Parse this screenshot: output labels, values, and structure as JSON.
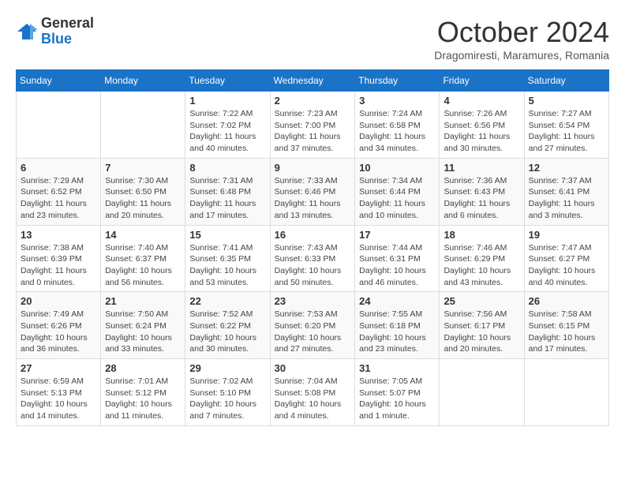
{
  "header": {
    "logo_general": "General",
    "logo_blue": "Blue",
    "month_title": "October 2024",
    "location": "Dragomiresti, Maramures, Romania"
  },
  "weekdays": [
    "Sunday",
    "Monday",
    "Tuesday",
    "Wednesday",
    "Thursday",
    "Friday",
    "Saturday"
  ],
  "weeks": [
    [
      {
        "day": "",
        "info": ""
      },
      {
        "day": "",
        "info": ""
      },
      {
        "day": "1",
        "info": "Sunrise: 7:22 AM\nSunset: 7:02 PM\nDaylight: 11 hours and 40 minutes."
      },
      {
        "day": "2",
        "info": "Sunrise: 7:23 AM\nSunset: 7:00 PM\nDaylight: 11 hours and 37 minutes."
      },
      {
        "day": "3",
        "info": "Sunrise: 7:24 AM\nSunset: 6:58 PM\nDaylight: 11 hours and 34 minutes."
      },
      {
        "day": "4",
        "info": "Sunrise: 7:26 AM\nSunset: 6:56 PM\nDaylight: 11 hours and 30 minutes."
      },
      {
        "day": "5",
        "info": "Sunrise: 7:27 AM\nSunset: 6:54 PM\nDaylight: 11 hours and 27 minutes."
      }
    ],
    [
      {
        "day": "6",
        "info": "Sunrise: 7:29 AM\nSunset: 6:52 PM\nDaylight: 11 hours and 23 minutes."
      },
      {
        "day": "7",
        "info": "Sunrise: 7:30 AM\nSunset: 6:50 PM\nDaylight: 11 hours and 20 minutes."
      },
      {
        "day": "8",
        "info": "Sunrise: 7:31 AM\nSunset: 6:48 PM\nDaylight: 11 hours and 17 minutes."
      },
      {
        "day": "9",
        "info": "Sunrise: 7:33 AM\nSunset: 6:46 PM\nDaylight: 11 hours and 13 minutes."
      },
      {
        "day": "10",
        "info": "Sunrise: 7:34 AM\nSunset: 6:44 PM\nDaylight: 11 hours and 10 minutes."
      },
      {
        "day": "11",
        "info": "Sunrise: 7:36 AM\nSunset: 6:43 PM\nDaylight: 11 hours and 6 minutes."
      },
      {
        "day": "12",
        "info": "Sunrise: 7:37 AM\nSunset: 6:41 PM\nDaylight: 11 hours and 3 minutes."
      }
    ],
    [
      {
        "day": "13",
        "info": "Sunrise: 7:38 AM\nSunset: 6:39 PM\nDaylight: 11 hours and 0 minutes."
      },
      {
        "day": "14",
        "info": "Sunrise: 7:40 AM\nSunset: 6:37 PM\nDaylight: 10 hours and 56 minutes."
      },
      {
        "day": "15",
        "info": "Sunrise: 7:41 AM\nSunset: 6:35 PM\nDaylight: 10 hours and 53 minutes."
      },
      {
        "day": "16",
        "info": "Sunrise: 7:43 AM\nSunset: 6:33 PM\nDaylight: 10 hours and 50 minutes."
      },
      {
        "day": "17",
        "info": "Sunrise: 7:44 AM\nSunset: 6:31 PM\nDaylight: 10 hours and 46 minutes."
      },
      {
        "day": "18",
        "info": "Sunrise: 7:46 AM\nSunset: 6:29 PM\nDaylight: 10 hours and 43 minutes."
      },
      {
        "day": "19",
        "info": "Sunrise: 7:47 AM\nSunset: 6:27 PM\nDaylight: 10 hours and 40 minutes."
      }
    ],
    [
      {
        "day": "20",
        "info": "Sunrise: 7:49 AM\nSunset: 6:26 PM\nDaylight: 10 hours and 36 minutes."
      },
      {
        "day": "21",
        "info": "Sunrise: 7:50 AM\nSunset: 6:24 PM\nDaylight: 10 hours and 33 minutes."
      },
      {
        "day": "22",
        "info": "Sunrise: 7:52 AM\nSunset: 6:22 PM\nDaylight: 10 hours and 30 minutes."
      },
      {
        "day": "23",
        "info": "Sunrise: 7:53 AM\nSunset: 6:20 PM\nDaylight: 10 hours and 27 minutes."
      },
      {
        "day": "24",
        "info": "Sunrise: 7:55 AM\nSunset: 6:18 PM\nDaylight: 10 hours and 23 minutes."
      },
      {
        "day": "25",
        "info": "Sunrise: 7:56 AM\nSunset: 6:17 PM\nDaylight: 10 hours and 20 minutes."
      },
      {
        "day": "26",
        "info": "Sunrise: 7:58 AM\nSunset: 6:15 PM\nDaylight: 10 hours and 17 minutes."
      }
    ],
    [
      {
        "day": "27",
        "info": "Sunrise: 6:59 AM\nSunset: 5:13 PM\nDaylight: 10 hours and 14 minutes."
      },
      {
        "day": "28",
        "info": "Sunrise: 7:01 AM\nSunset: 5:12 PM\nDaylight: 10 hours and 11 minutes."
      },
      {
        "day": "29",
        "info": "Sunrise: 7:02 AM\nSunset: 5:10 PM\nDaylight: 10 hours and 7 minutes."
      },
      {
        "day": "30",
        "info": "Sunrise: 7:04 AM\nSunset: 5:08 PM\nDaylight: 10 hours and 4 minutes."
      },
      {
        "day": "31",
        "info": "Sunrise: 7:05 AM\nSunset: 5:07 PM\nDaylight: 10 hours and 1 minute."
      },
      {
        "day": "",
        "info": ""
      },
      {
        "day": "",
        "info": ""
      }
    ]
  ]
}
